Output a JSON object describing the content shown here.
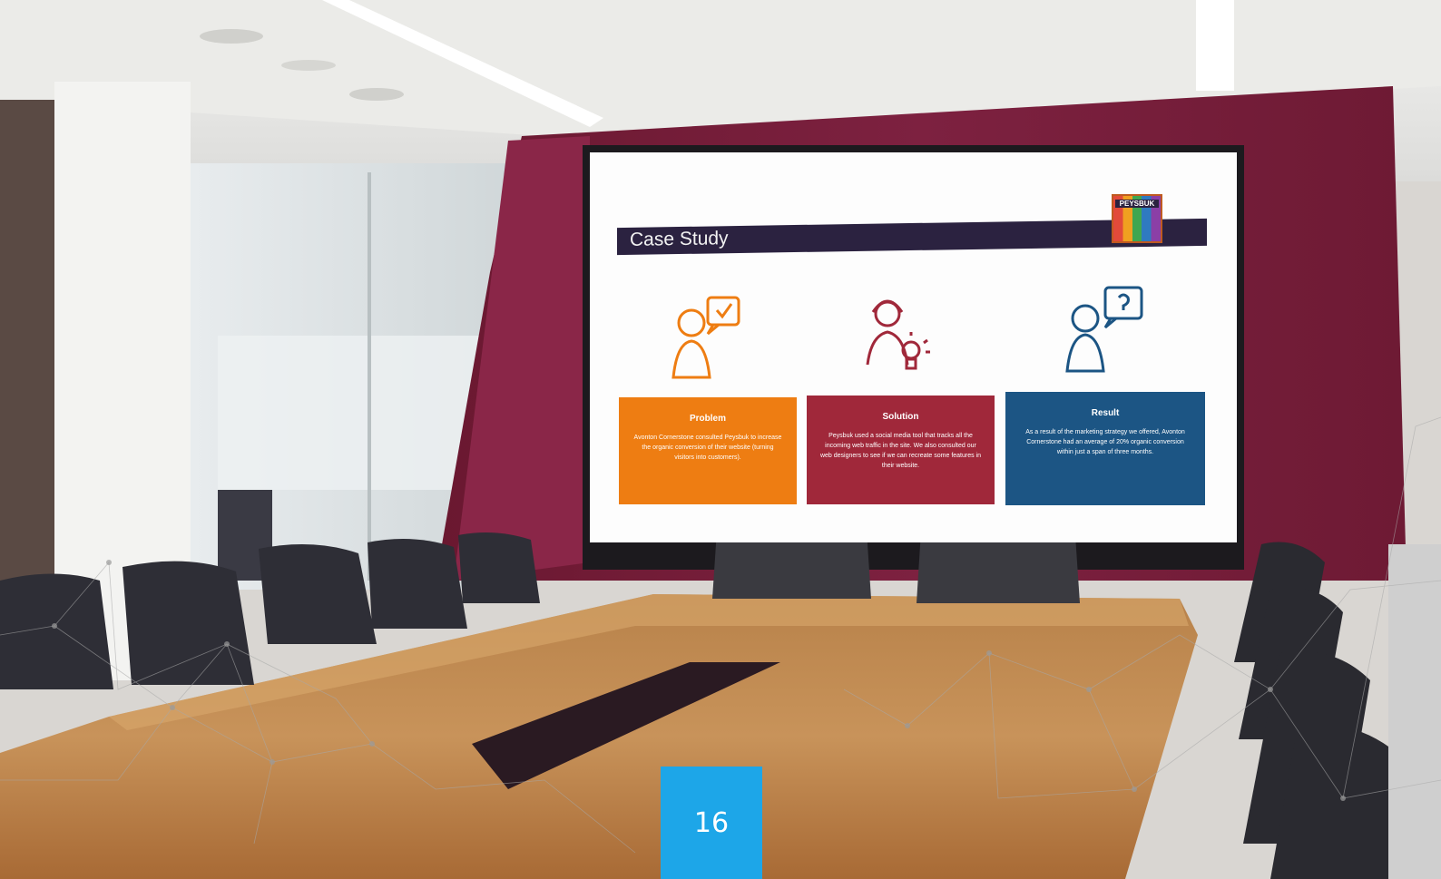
{
  "slide": {
    "title": "Case Study",
    "logo_text": "PEYSBUK",
    "columns": [
      {
        "heading": "Problem",
        "body": "Avonton Cornerstone consulted Peysbuk to increase the organic conversion of their website (turning visitors into customers).",
        "color": "#ee7d12",
        "icon": "person-checkmark-speech-icon"
      },
      {
        "heading": "Solution",
        "body": "Peysbuk used a social media tool that tracks all the incoming web traffic in the site. We also consulted our web designers to see if we can recreate some features in their website.",
        "color": "#a0283a",
        "icon": "support-agent-lightbulb-icon"
      },
      {
        "heading": "Result",
        "body": "As a result of the marketing strategy we offered, Avonton Cornerstone had an average of 20% organic conversion within just a span of three months.",
        "color": "#1c5584",
        "icon": "person-question-speech-icon"
      }
    ]
  },
  "page_number": "16",
  "colors": {
    "wall": "#7a1f3a",
    "badge": "#1da6e8",
    "title_bar": "#2b2240"
  }
}
